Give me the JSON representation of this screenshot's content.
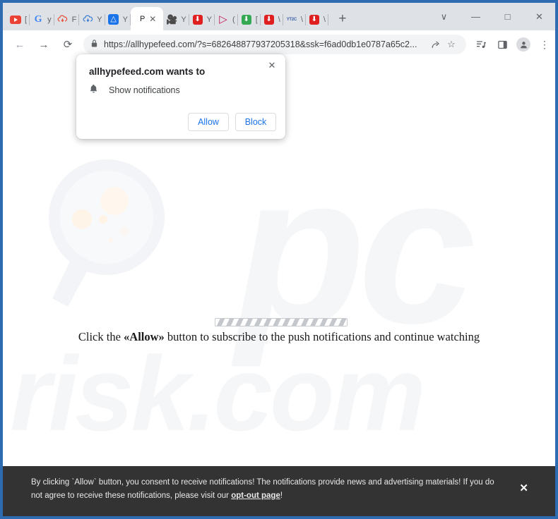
{
  "browser": {
    "tabs": [
      {
        "title": "[",
        "favicon": "youtube-icon"
      },
      {
        "title": "y",
        "favicon": "google-icon"
      },
      {
        "title": "F",
        "favicon": "red-cloud-download-icon"
      },
      {
        "title": "Y",
        "favicon": "blue-cloud-download-icon"
      },
      {
        "title": "Y",
        "favicon": "blue-square-icon"
      },
      {
        "title": "P",
        "favicon": "page-icon",
        "active": true
      },
      {
        "title": "Y",
        "favicon": "camera-icon"
      },
      {
        "title": "Y",
        "favicon": "red-download-icon"
      },
      {
        "title": "(",
        "favicon": "play-icon"
      },
      {
        "title": "[",
        "favicon": "green-download-icon"
      },
      {
        "title": "\\",
        "favicon": "red-download-icon"
      },
      {
        "title": "\\",
        "favicon": "yt2c-icon"
      },
      {
        "title": "\\",
        "favicon": "red-download-icon"
      }
    ],
    "new_tab_label": "+",
    "window_controls": {
      "tab_search": "∨",
      "minimize": "—",
      "maximize": "□",
      "close": "✕"
    },
    "toolbar": {
      "back": "←",
      "forward": "→",
      "reload": "⟳",
      "lock": "🔒",
      "url": "https://allhypefeed.com/?s=682648877937205318&ssk=f6ad0db1e0787a65c2...",
      "share": "↱",
      "bookmark": "☆",
      "reading_list": "≡",
      "side_panel": "▣",
      "profile": "●",
      "menu": "⋮"
    }
  },
  "dialog": {
    "title": "allhypefeed.com wants to",
    "permission": "Show notifications",
    "bell_icon": "🔔",
    "allow_label": "Allow",
    "block_label": "Block",
    "close_label": "✕"
  },
  "page": {
    "message_prefix": "Click the «Allow»",
    "message_before": "Click the ",
    "message_bold": "«Allow»",
    "message_after": " button to subscribe to the push notifications and continue watching",
    "watermark_pc": "pc",
    "watermark_risk": "risk.com"
  },
  "banner": {
    "line1": "By clicking `Allow` button, you consent to receive notifications! The notifications provide news and advertising materials! If you do not",
    "line2_before": "agree to receive these notifications, please visit our ",
    "link": "opt-out page",
    "line2_after": "!",
    "close_label": "✕"
  },
  "colors": {
    "frame": "#2f6bb0",
    "tabstrip": "#dee1e6",
    "accent": "#1a73e8",
    "banner_bg": "#333333"
  }
}
